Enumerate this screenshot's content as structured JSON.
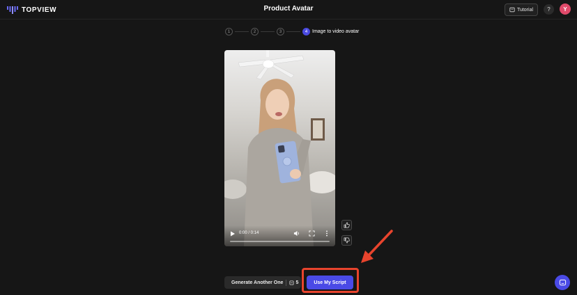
{
  "header": {
    "logo_text": "TOPVIEW",
    "page_title": "Product Avatar",
    "tutorial_label": "Tutorial",
    "help_label": "?",
    "user_initial": "Y"
  },
  "stepper": {
    "steps": [
      "1",
      "2",
      "3",
      "4"
    ],
    "active_index": 3,
    "active_label": "Image to video avatar"
  },
  "video": {
    "time_display": "0:00 / 0:14",
    "progress": 0
  },
  "actions": {
    "generate_label": "Generate Another One",
    "credit_cost": "5",
    "use_script_label": "Use My Script"
  },
  "colors": {
    "accent": "#4a4ae6",
    "highlight": "#e8442d",
    "avatar_bg": "#e04a6a"
  },
  "icons": {
    "logo": "topview-bars-icon",
    "tutorial": "book-icon",
    "play": "play-icon",
    "volume": "volume-icon",
    "fullscreen": "fullscreen-icon",
    "more": "more-vertical-icon",
    "like": "thumbs-up-icon",
    "dislike": "thumbs-down-icon",
    "credit": "coin-icon",
    "chat": "chat-icon"
  }
}
